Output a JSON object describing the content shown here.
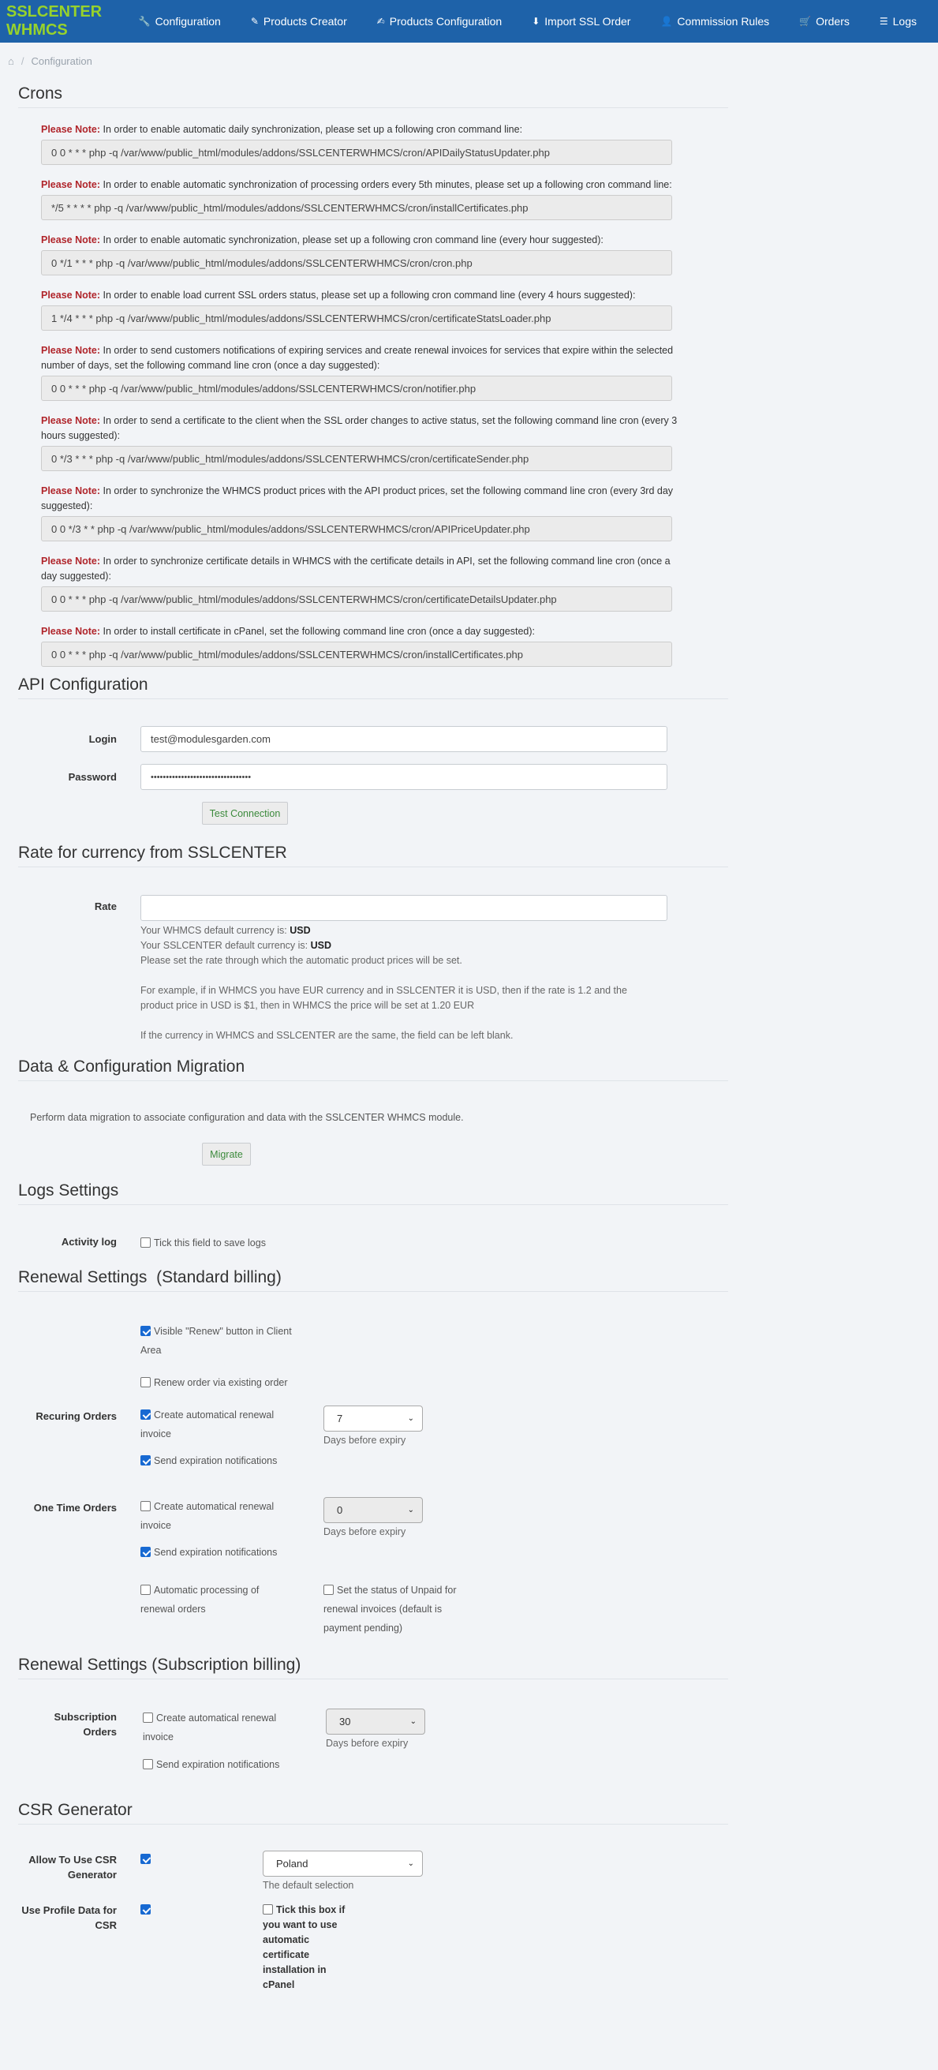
{
  "nav": {
    "brand": "SSLCENTER WHMCS",
    "items": [
      {
        "icon": "wrench-icon",
        "glyph": "🔧",
        "label": "Configuration"
      },
      {
        "icon": "magic-wand-icon",
        "glyph": "✎",
        "label": "Products Creator"
      },
      {
        "icon": "edit-icon",
        "glyph": "✍",
        "label": "Products Configuration"
      },
      {
        "icon": "download-icon",
        "glyph": "⬇",
        "label": "Import SSL Order"
      },
      {
        "icon": "user-plus-icon",
        "glyph": "👤",
        "label": "Commission Rules"
      },
      {
        "icon": "cart-icon",
        "glyph": "🛒",
        "label": "Orders"
      },
      {
        "icon": "list-icon",
        "glyph": "☰",
        "label": "Logs"
      }
    ]
  },
  "breadcrumb": {
    "home_glyph": "⌂",
    "current": "Configuration"
  },
  "crons": {
    "title": "Crons",
    "note_prefix": "Please Note:",
    "items": [
      {
        "text": " In order to enable automatic daily synchronization, please set up a following cron command line:",
        "cmd": "0 0 * * * php -q /var/www/public_html/modules/addons/SSLCENTERWHMCS/cron/APIDailyStatusUpdater.php"
      },
      {
        "text": " In order to enable automatic synchronization of processing orders every 5th minutes, please set up a following cron command line:",
        "cmd": "*/5 * * * * php -q /var/www/public_html/modules/addons/SSLCENTERWHMCS/cron/installCertificates.php"
      },
      {
        "text": " In order to enable automatic synchronization, please set up a following cron command line (every hour suggested):",
        "cmd": "0 */1 * * * php -q /var/www/public_html/modules/addons/SSLCENTERWHMCS/cron/cron.php"
      },
      {
        "text": " In order to enable load current SSL orders status, please set up a following cron command line (every 4 hours suggested):",
        "cmd": "1 */4 * * * php -q /var/www/public_html/modules/addons/SSLCENTERWHMCS/cron/certificateStatsLoader.php"
      },
      {
        "text": " In order to send customers notifications of expiring services and create renewal invoices for services that expire within the selected number of days, set the following command line cron (once a day suggested):",
        "cmd": "0 0 * * * php -q /var/www/public_html/modules/addons/SSLCENTERWHMCS/cron/notifier.php"
      },
      {
        "text": " In order to send a certificate to the client when the SSL order changes to active status, set the following command line cron (every 3 hours suggested):",
        "cmd": "0 */3 * * * php -q /var/www/public_html/modules/addons/SSLCENTERWHMCS/cron/certificateSender.php"
      },
      {
        "text": " In order to synchronize the WHMCS product prices with the API product prices, set the following command line cron (every 3rd day suggested):",
        "cmd": "0 0 */3 * * php -q /var/www/public_html/modules/addons/SSLCENTERWHMCS/cron/APIPriceUpdater.php"
      },
      {
        "text": " In order to synchronize certificate details in WHMCS with the certificate details in API, set the following command line cron (once a day suggested):",
        "cmd": "0 0 * * * php -q /var/www/public_html/modules/addons/SSLCENTERWHMCS/cron/certificateDetailsUpdater.php"
      },
      {
        "text": " In order to install certificate in cPanel, set the following command line cron (once a day suggested):",
        "cmd": "0 0 * * * php -q /var/www/public_html/modules/addons/SSLCENTERWHMCS/cron/installCertificates.php"
      }
    ]
  },
  "api": {
    "title": "API Configuration",
    "login_label": "Login",
    "login_value": "test@modulesgarden.com",
    "password_label": "Password",
    "password_value": "•••••••••••••••••••••••••••••••••",
    "test_button": "Test Connection"
  },
  "rate": {
    "title": "Rate for currency from SSLCENTER",
    "label": "Rate",
    "value": "",
    "whmcs_line": "Your WHMCS default currency is:",
    "whmcs_currency": "USD",
    "sslcenter_line": "Your SSLCENTER default currency is:",
    "sslcenter_currency": "USD",
    "help1": "Please set the rate through which the automatic product prices will be set.",
    "help2": "For example, if in WHMCS you have EUR currency and in SSLCENTER it is USD, then if the rate is 1.2 and the product price in USD is $1, then in WHMCS the price will be set at 1.20 EUR",
    "help3": "If the currency in WHMCS and SSLCENTER are the same, the field can be left blank."
  },
  "migration": {
    "title": "Data & Configuration Migration",
    "text": "Perform data migration to associate configuration and data with the SSLCENTER WHMCS module.",
    "button": "Migrate"
  },
  "logs": {
    "title": "Logs Settings",
    "label": "Activity log",
    "checkbox": "Tick this field to save logs"
  },
  "renewal_standard": {
    "title": "Renewal Settings  (Standard billing)",
    "visible_renew_a": "Visible \"Renew\" button in Client",
    "visible_renew_b": "Area",
    "renew_existing": "Renew order via existing order",
    "recurring_label": "Recuring Orders",
    "create_invoice_a": "Create automatical renewal",
    "create_invoice_b": "invoice",
    "recurring_days": "7",
    "days_before": "Days before expiry",
    "send_notifications": "Send expiration notifications",
    "onetime_label": "One Time Orders",
    "onetime_days": "0",
    "auto_processing_a": "Automatic processing of",
    "auto_processing_b": "renewal orders",
    "unpaid_a": "Set the status of Unpaid for",
    "unpaid_b": "renewal invoices (default is",
    "unpaid_c": "payment pending)"
  },
  "renewal_subscription": {
    "title": "Renewal Settings (Subscription billing)",
    "label_a": "Subscription",
    "label_b": "Orders",
    "create_invoice_a": "Create automatical renewal",
    "create_invoice_b": "invoice",
    "days": "30",
    "days_before": "Days before expiry",
    "send_notifications": "Send expiration notifications"
  },
  "csr": {
    "title": "CSR Generator",
    "allow_a": "Allow To Use CSR",
    "allow_b": "Generator",
    "country": "Poland",
    "default_selection": "The default selection",
    "profile_a": "Use Profile Data for",
    "profile_b": "CSR",
    "tick_a": "Tick this box if",
    "tick_b": "you want to use",
    "tick_c": "automatic",
    "tick_d": "certificate",
    "tick_e": "installation in",
    "tick_f": "cPanel"
  }
}
